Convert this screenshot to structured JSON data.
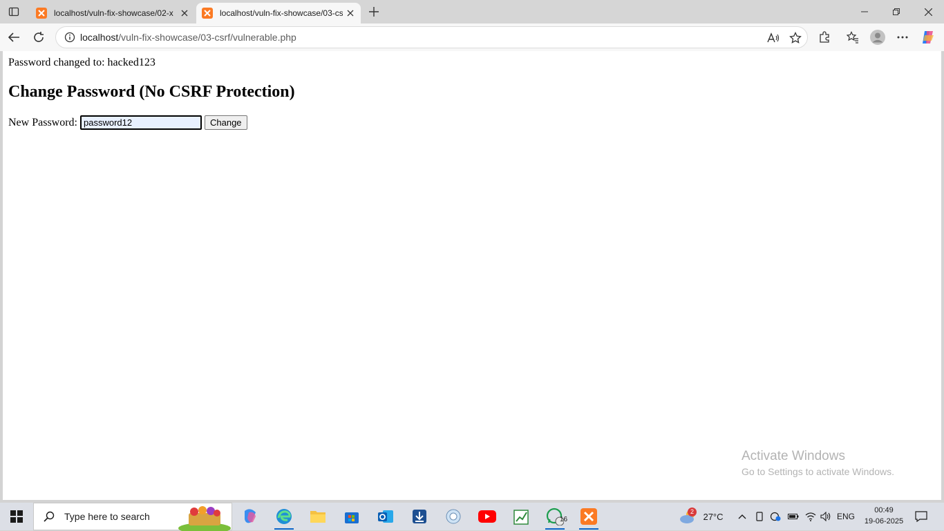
{
  "browser": {
    "tabs": [
      {
        "title": "localhost/vuln-fix-showcase/02-x",
        "active": false
      },
      {
        "title": "localhost/vuln-fix-showcase/03-cs",
        "active": true
      }
    ],
    "address": {
      "host": "localhost",
      "path": "/vuln-fix-showcase/03-csrf/vulnerable.php"
    }
  },
  "page": {
    "message": "Password changed to: hacked123",
    "heading": "Change Password (No CSRF Protection)",
    "form": {
      "label": "New Password:",
      "value": "password12",
      "button": "Change"
    }
  },
  "watermark": {
    "line1": "Activate Windows",
    "line2": "Go to Settings to activate Windows."
  },
  "taskbar": {
    "search_placeholder": "Type here to search",
    "weather": {
      "temp": "27°C",
      "badge": "2"
    },
    "whatsapp_badge": "16",
    "language": "ENG",
    "time": "00:49",
    "date": "19-06-2025"
  },
  "colors": {
    "accent": "#0a64c8",
    "xampp": "#fb7a24",
    "youtube": "#ff0000"
  }
}
